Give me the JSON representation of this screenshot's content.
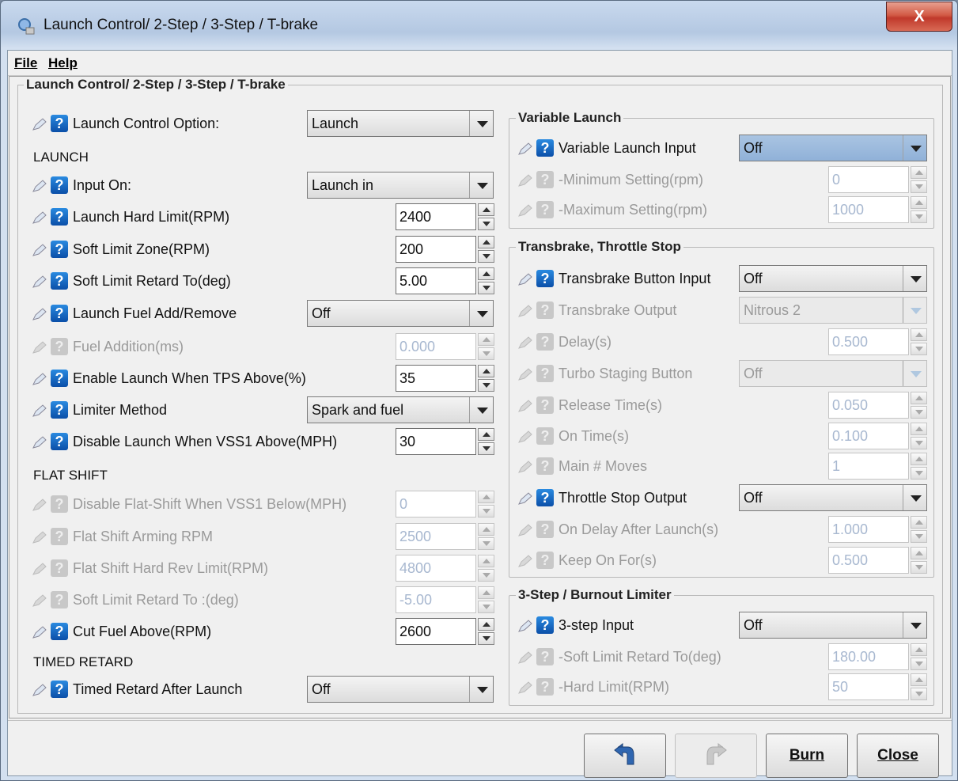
{
  "window": {
    "title": "Launch Control/ 2-Step / 3-Step / T-brake",
    "close_label": "X"
  },
  "menu": {
    "file": "File",
    "help": "Help"
  },
  "main_group": {
    "title": "Launch Control/ 2-Step / 3-Step / T-brake"
  },
  "help_glyph": "?",
  "left": {
    "launch_option": {
      "label": "Launch Control Option:",
      "value": "Launch"
    },
    "section_launch": "LAUNCH",
    "input_on": {
      "label": "Input On:",
      "value": "Launch in"
    },
    "hard_limit": {
      "label": "Launch Hard Limit(RPM)",
      "value": "2400"
    },
    "soft_zone": {
      "label": "Soft Limit Zone(RPM)",
      "value": "200"
    },
    "soft_retard": {
      "label": "Soft Limit Retard To(deg)",
      "value": "5.00"
    },
    "fuel_add_remove": {
      "label": "Launch Fuel Add/Remove",
      "value": "Off"
    },
    "fuel_addition": {
      "label": "Fuel Addition(ms)",
      "value": "0.000"
    },
    "enable_tps": {
      "label": "Enable Launch When TPS Above(%)",
      "value": "35"
    },
    "limiter_method": {
      "label": "Limiter Method",
      "value": "Spark and fuel"
    },
    "disable_vss": {
      "label": "Disable Launch When VSS1 Above(MPH)",
      "value": "30"
    },
    "section_flat": "FLAT SHIFT",
    "flat_disable_vss": {
      "label": "Disable Flat-Shift When VSS1 Below(MPH)",
      "value": "0"
    },
    "flat_arming": {
      "label": "Flat Shift Arming RPM",
      "value": "2500"
    },
    "flat_hard": {
      "label": "Flat Shift Hard Rev Limit(RPM)",
      "value": "4800"
    },
    "flat_soft_retard": {
      "label": "Soft Limit Retard To :(deg)",
      "value": "-5.00"
    },
    "cut_fuel": {
      "label": "Cut Fuel Above(RPM)",
      "value": "2600"
    },
    "section_timed": "TIMED RETARD",
    "timed_retard": {
      "label": "Timed Retard After Launch",
      "value": "Off"
    }
  },
  "variable_launch": {
    "title": "Variable Launch",
    "input": {
      "label": "Variable Launch Input",
      "value": "Off"
    },
    "min": {
      "label": "-Minimum Setting(rpm)",
      "value": "0"
    },
    "max": {
      "label": "-Maximum Setting(rpm)",
      "value": "1000"
    }
  },
  "transbrake": {
    "title": "Transbrake, Throttle Stop",
    "button_input": {
      "label": "Transbrake Button Input",
      "value": "Off"
    },
    "output": {
      "label": "Transbrake Output",
      "value": "Nitrous 2"
    },
    "delay": {
      "label": "Delay(s)",
      "value": "0.500"
    },
    "turbo_staging": {
      "label": "Turbo Staging Button",
      "value": "Off"
    },
    "release_time": {
      "label": "Release Time(s)",
      "value": "0.050"
    },
    "on_time": {
      "label": "On Time(s)",
      "value": "0.100"
    },
    "main_moves": {
      "label": "Main # Moves",
      "value": "1"
    },
    "throttle_stop": {
      "label": "Throttle Stop Output",
      "value": "Off"
    },
    "on_delay": {
      "label": "On Delay After Launch(s)",
      "value": "1.000"
    },
    "keep_on": {
      "label": "Keep On For(s)",
      "value": "0.500"
    }
  },
  "three_step": {
    "title": "3-Step / Burnout Limiter",
    "input": {
      "label": "3-step Input",
      "value": "Off"
    },
    "soft_retard": {
      "label": "-Soft Limit Retard To(deg)",
      "value": "180.00"
    },
    "hard_limit": {
      "label": "-Hard Limit(RPM)",
      "value": "50"
    }
  },
  "buttons": {
    "burn": "Burn",
    "close": "Close"
  }
}
